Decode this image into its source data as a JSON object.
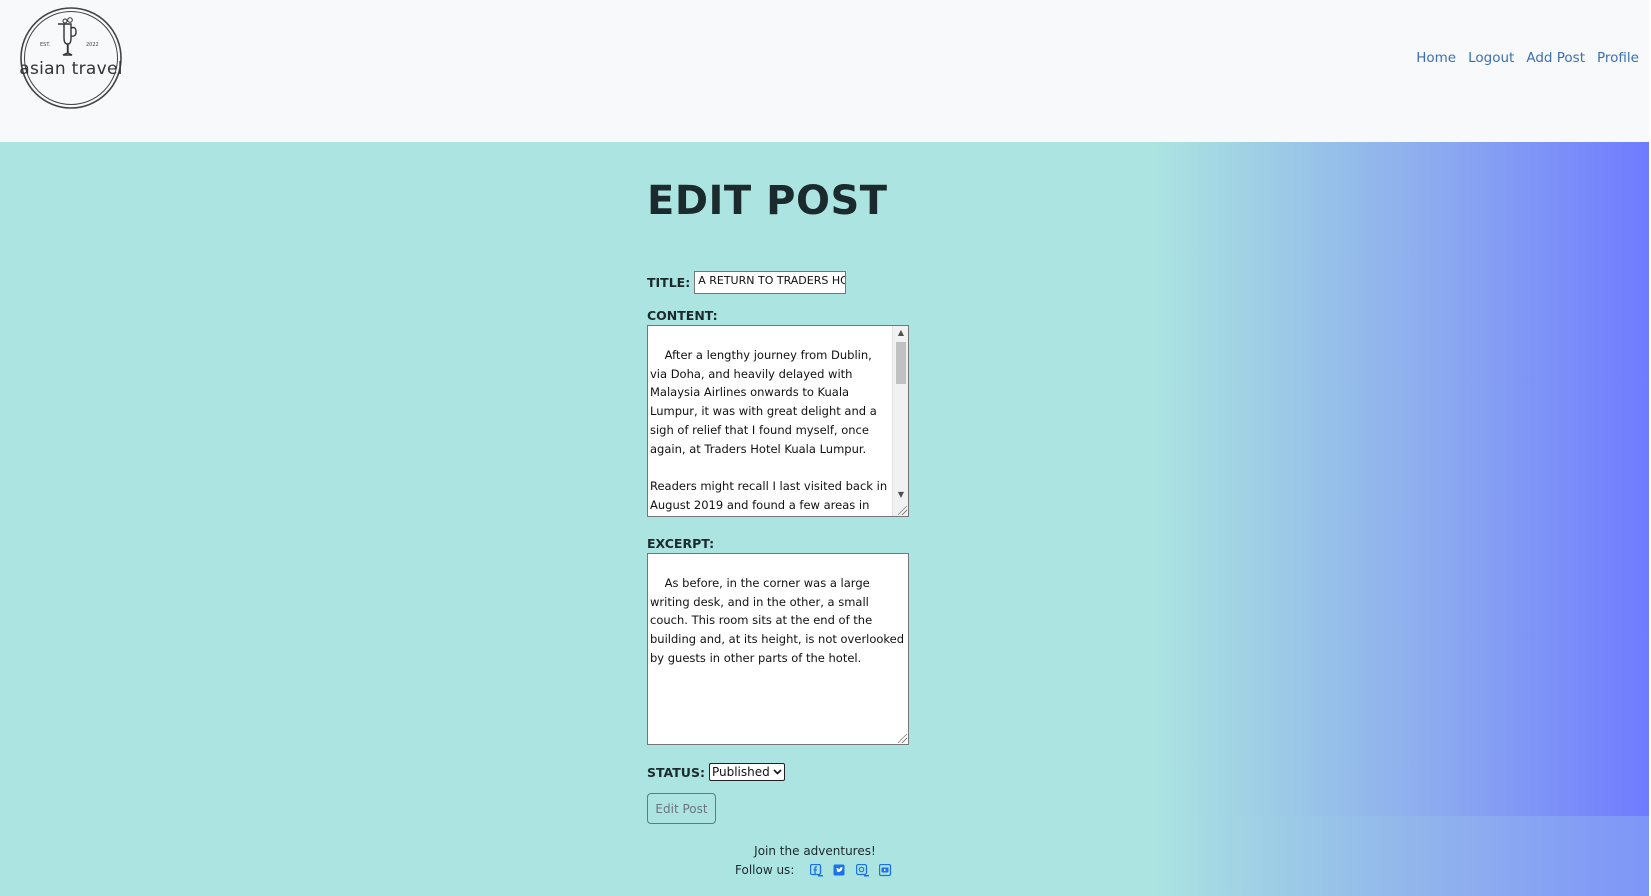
{
  "brand": {
    "logo_text": "asian travel",
    "logo_est": "EST.",
    "logo_year": "2022"
  },
  "nav": {
    "items": [
      "Home",
      "Logout",
      "Add Post",
      "Profile"
    ],
    "link_color": "#3a6fb5"
  },
  "page": {
    "title": "EDIT POST"
  },
  "form": {
    "title_label": "TITLE:",
    "title_value": "A RETURN TO TRADERS HOTEL",
    "content_label": "CONTENT:",
    "content_value": "After a lengthy journey from Dublin, via Doha, and heavily delayed with Malaysia Airlines onwards to Kuala Lumpur, it was with great delight and a sigh of relief that I found myself, once again, at Traders Hotel Kuala Lumpur.\n\nReaders might recall I last visited back in August 2019 and found a few areas in need of attention and/or improvement – so I was",
    "excerpt_label": "EXCERPT:",
    "excerpt_value": "As before, in the corner was a large writing desk, and in the other, a small couch. This room sits at the end of the building and, at its height, is not overlooked by guests in other parts of the hotel.",
    "status_label": "STATUS:",
    "status_value": "Published",
    "submit_label": "Edit Post"
  },
  "footer": {
    "join_text": "Join the adventures!",
    "follow_label": "Follow us:",
    "social_icons": [
      "facebook-icon",
      "twitter-icon",
      "instagram-icon",
      "youtube-icon"
    ],
    "icon_color": "#1a73e8"
  },
  "colors": {
    "navbar_bg": "#f8f9fa",
    "main_bg": "#abe4e1",
    "gradient_end": "#6f7bff",
    "heading": "#1b2a2d"
  }
}
